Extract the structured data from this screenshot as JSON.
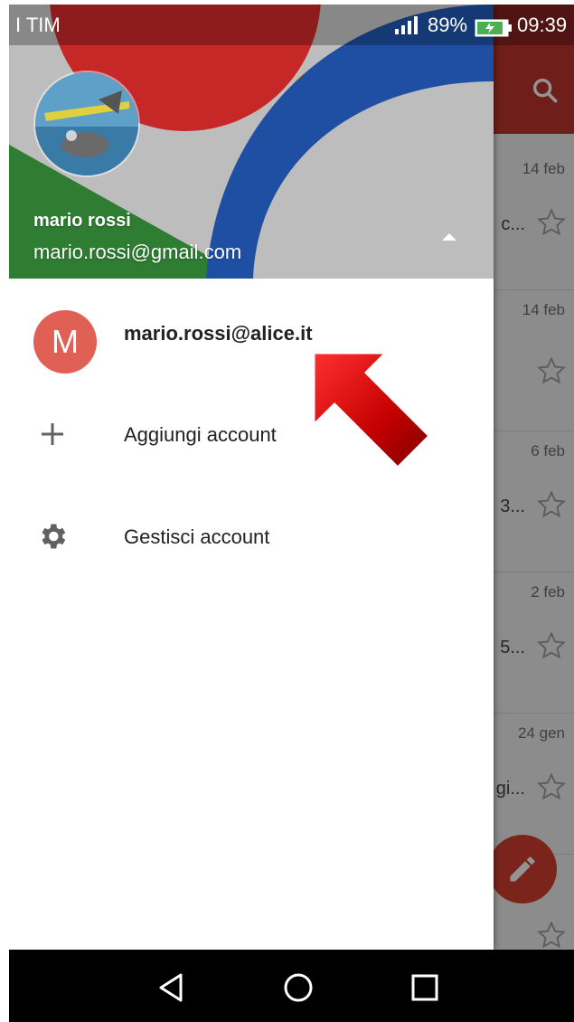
{
  "status_bar": {
    "carrier": "I TIM",
    "battery": "89%",
    "time": "09:39"
  },
  "drawer": {
    "header": {
      "name": "mario rossi",
      "email": "mario.rossi@gmail.com"
    },
    "accounts": [
      {
        "initial": "M",
        "email": "mario.rossi@alice.it"
      }
    ],
    "actions": [
      {
        "label": "Aggiungi account",
        "icon": "plus-icon"
      },
      {
        "label": "Gestisci account",
        "icon": "gear-icon"
      }
    ]
  },
  "background_inbox": {
    "dates": [
      "14 feb",
      "14 feb",
      "6 feb",
      "2 feb",
      "24 gen"
    ],
    "snippets": [
      "c...",
      "",
      "3...",
      "5...",
      "gi..."
    ]
  },
  "colors": {
    "gmail_red": "#c1352b",
    "avatar_red": "#e06055",
    "fab_red": "#d23f31"
  }
}
